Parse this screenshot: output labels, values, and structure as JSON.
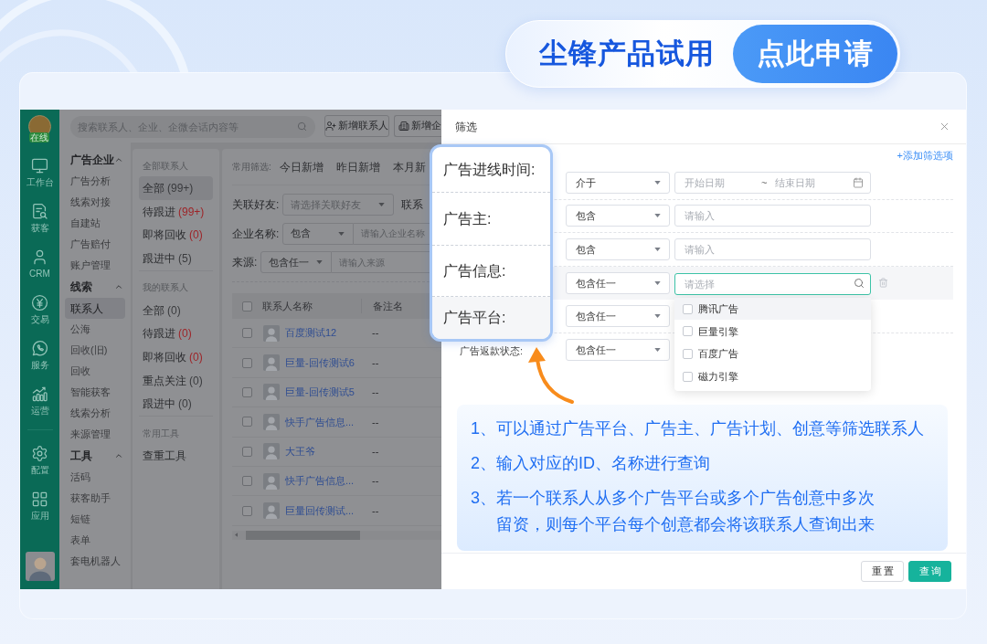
{
  "banner": {
    "title": "尘锋产品试用",
    "button": "点此申请"
  },
  "app": {
    "sidebar": {
      "status": "在线",
      "items": [
        {
          "label": "工作台"
        },
        {
          "label": "获客"
        },
        {
          "label": "CRM"
        },
        {
          "label": "交易"
        },
        {
          "label": "服务"
        },
        {
          "label": "运营"
        }
      ],
      "lower_items": [
        {
          "label": "配置"
        },
        {
          "label": "应用"
        }
      ]
    },
    "search": {
      "placeholder": "搜索联系人、企业、企微会话内容等"
    },
    "toolbar_buttons": [
      {
        "label": "新增联系人"
      },
      {
        "label": "新增企"
      }
    ],
    "nav": [
      {
        "title": "广告企业",
        "expanded": true,
        "items": [
          {
            "label": "广告分析",
            "selected": false
          },
          {
            "label": "线索对接",
            "selected": false
          },
          {
            "label": "自建站",
            "selected": false
          },
          {
            "label": "广告赔付",
            "selected": false
          },
          {
            "label": "账户管理",
            "selected": false
          }
        ]
      },
      {
        "title": "线索",
        "expanded": true,
        "items": [
          {
            "label": "联系人",
            "selected": true
          },
          {
            "label": "公海",
            "selected": false
          },
          {
            "label": "回收(旧)",
            "selected": false
          },
          {
            "label": "回收",
            "selected": false
          },
          {
            "label": "智能获客",
            "selected": false
          },
          {
            "label": "线索分析",
            "selected": false
          },
          {
            "label": "来源管理",
            "selected": false
          }
        ]
      },
      {
        "title": "工具",
        "expanded": true,
        "items": [
          {
            "label": "活码",
            "selected": false
          },
          {
            "label": "获客助手",
            "selected": false
          },
          {
            "label": "短链",
            "selected": false
          },
          {
            "label": "表单",
            "selected": false
          },
          {
            "label": "套电机器人",
            "selected": false
          }
        ]
      }
    ],
    "contact_groups": [
      {
        "title": "全部联系人",
        "items": [
          {
            "label": "全部",
            "count": "(99+)",
            "alert": false,
            "selected": true
          },
          {
            "label": "待跟进",
            "count": "(99+)",
            "alert": true,
            "selected": false
          },
          {
            "label": "即将回收",
            "count": "(0)",
            "alert": true,
            "selected": false
          },
          {
            "label": "跟进中",
            "count": "(5)",
            "alert": false,
            "selected": false
          }
        ]
      },
      {
        "title": "我的联系人",
        "items": [
          {
            "label": "全部",
            "count": "(0)",
            "alert": false,
            "selected": false
          },
          {
            "label": "待跟进",
            "count": "(0)",
            "alert": true,
            "selected": false
          },
          {
            "label": "即将回收",
            "count": "(0)",
            "alert": true,
            "selected": false
          },
          {
            "label": "重点关注",
            "count": "(0)",
            "alert": false,
            "selected": false
          },
          {
            "label": "跟进中",
            "count": "(0)",
            "alert": false,
            "selected": false
          }
        ]
      },
      {
        "title": "常用工具",
        "items": [
          {
            "label": "查重工具",
            "selected": false
          }
        ]
      }
    ],
    "quick_filter": {
      "label": "常用筛选:",
      "options": [
        "今日新增",
        "昨日新增",
        "本月新"
      ]
    },
    "filters": [
      {
        "kind": "select",
        "label": "关联好友:",
        "placeholder": "请选择关联好友",
        "next_label": "联系"
      },
      {
        "kind": "operator_input",
        "label": "企业名称:",
        "operator": "包含",
        "placeholder": "请输入企业名称"
      },
      {
        "kind": "operator_input",
        "label": "来源:",
        "operator": "包含任一",
        "placeholder": "请输入来源"
      }
    ],
    "table": {
      "columns": [
        "联系人名称",
        "备注名"
      ],
      "header_checked": false,
      "rows": [
        {
          "name": "百度测试12",
          "remark": "--",
          "checked": false
        },
        {
          "name": "巨量-回传测试6",
          "remark": "--",
          "checked": false
        },
        {
          "name": "巨量-回传测试5",
          "remark": "--",
          "checked": false
        },
        {
          "name": "快手广告信息...",
          "remark": "--",
          "checked": false
        },
        {
          "name": "大王爷",
          "remark": "--",
          "checked": false
        },
        {
          "name": "快手广告信息...",
          "remark": "--",
          "checked": false
        },
        {
          "name": "巨量回传测试...",
          "remark": "--",
          "checked": false
        }
      ]
    }
  },
  "filter_panel": {
    "title": "筛选",
    "add_link": "+添加筛选项",
    "rows": [
      {
        "kind": "date_range",
        "operator": "介于",
        "start_placeholder": "开始日期",
        "separator": "~",
        "end_placeholder": "结束日期",
        "highlighted": false
      },
      {
        "kind": "text",
        "operator": "包含",
        "placeholder": "请输入",
        "highlighted": false
      },
      {
        "kind": "text",
        "operator": "包含",
        "placeholder": "请输入",
        "highlighted": false
      },
      {
        "kind": "search_select",
        "operator": "包含任一",
        "placeholder": "请选择",
        "highlighted": true,
        "focused": true,
        "expanded": true,
        "options": [
          {
            "label": "腾讯广告",
            "checked": false,
            "highlighted": true
          },
          {
            "label": "巨量引擎",
            "checked": false,
            "highlighted": false
          },
          {
            "label": "百度广告",
            "checked": false,
            "highlighted": false
          },
          {
            "label": "磁力引擎",
            "checked": false,
            "highlighted": false
          }
        ]
      },
      {
        "kind": "operator_only",
        "operator": "包含任一",
        "highlighted": false
      },
      {
        "kind": "operator_only",
        "label": "广告返款状态:",
        "operator": "包含任一",
        "highlighted": false
      }
    ],
    "buttons": [
      {
        "label": "重置",
        "kind": "secondary"
      },
      {
        "label": "查询",
        "kind": "primary"
      }
    ]
  },
  "callout": {
    "labels": [
      "广告进线时间:",
      "广告主:",
      "广告信息:",
      "广告平台:"
    ]
  },
  "notes": [
    "1、可以通过广告平台、广告主、广告计划、创意等筛选联系人",
    "2、输入对应的ID、名称进行查询",
    "3、若一个联系人从多个广告平台或多个广告创意中多次留资，则每个平台每个创意都会将该联系人查询出来"
  ]
}
